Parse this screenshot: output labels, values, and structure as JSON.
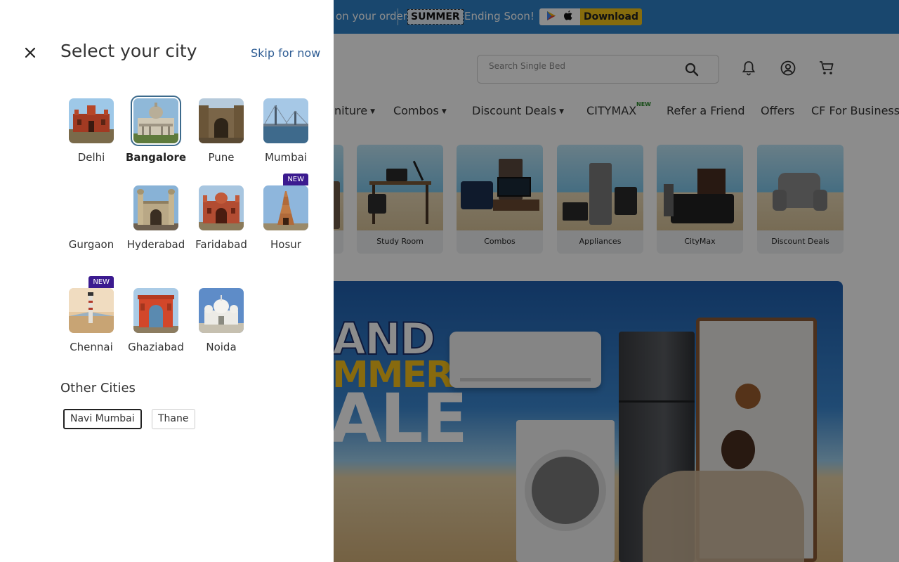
{
  "promo": {
    "text": "on your order",
    "coupon": "SUMMER",
    "ending": "Ending Soon!",
    "download_label": "Download"
  },
  "header": {
    "search_placeholder": "Search Single Bed"
  },
  "nav": {
    "items": [
      "niture",
      "Combos",
      "Discount Deals",
      "CITYMAX",
      "Refer a Friend",
      "Offers",
      "CF For Business"
    ],
    "new_badge": "NEW"
  },
  "categories": [
    "Study Room",
    "Combos",
    "Appliances",
    "CityMax",
    "Discount Deals"
  ],
  "banner": {
    "line1": "AND",
    "line2": "MMER",
    "line3": "ALE"
  },
  "drawer": {
    "title": "Select your city",
    "skip_label": "Skip for now",
    "cities": [
      {
        "name": "Delhi",
        "selected": false,
        "is_new": false
      },
      {
        "name": "Bangalore",
        "selected": true,
        "is_new": false
      },
      {
        "name": "Pune",
        "selected": false,
        "is_new": false
      },
      {
        "name": "Mumbai",
        "selected": false,
        "is_new": false
      },
      {
        "name": "Gurgaon",
        "selected": false,
        "is_new": false
      },
      {
        "name": "Hyderabad",
        "selected": false,
        "is_new": false
      },
      {
        "name": "Faridabad",
        "selected": false,
        "is_new": false
      },
      {
        "name": "Hosur",
        "selected": false,
        "is_new": true
      },
      {
        "name": "Chennai",
        "selected": false,
        "is_new": true
      },
      {
        "name": "Ghaziabad",
        "selected": false,
        "is_new": false
      },
      {
        "name": "Noida",
        "selected": false,
        "is_new": false
      }
    ],
    "new_tag": "NEW",
    "other_title": "Other Cities",
    "other_cities": [
      {
        "name": "Navi Mumbai",
        "active": true
      },
      {
        "name": "Thane",
        "active": false
      }
    ]
  },
  "colors": {
    "promo_bg": "#2e82c8",
    "download_btn": "#f5c518",
    "new_tag": "#3b1a8f",
    "skip_link": "#2f5d94",
    "selected_ring": "#3c6a8c"
  }
}
